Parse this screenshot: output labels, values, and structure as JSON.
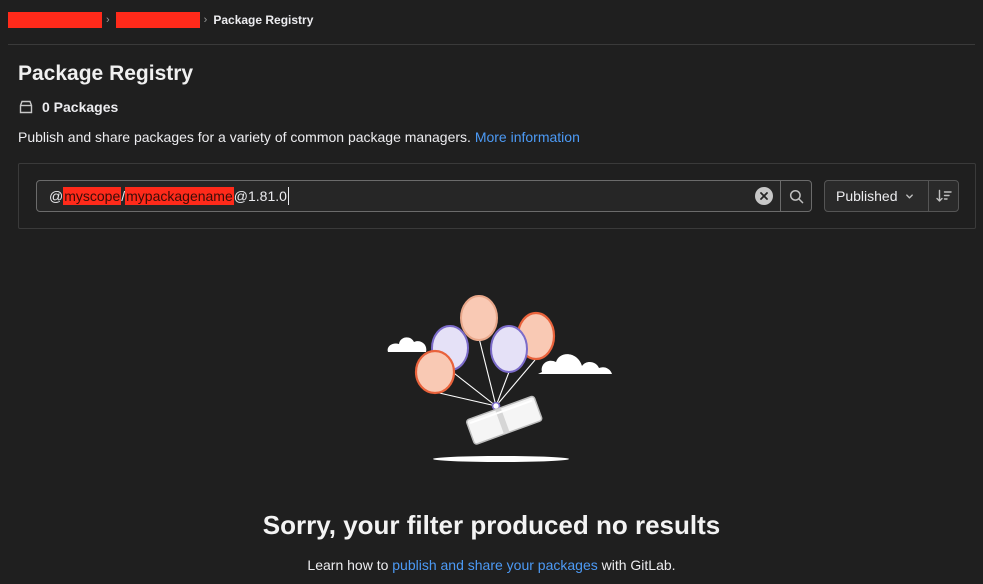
{
  "breadcrumb": {
    "items_redacted": [
      {
        "width": 94
      },
      {
        "width": 84
      }
    ],
    "separator": "›",
    "current": "Package Registry"
  },
  "header": {
    "title": "Package Registry",
    "count_label": "0 Packages",
    "description": "Publish and share packages for a variety of common package managers.",
    "more_info_link": "More information"
  },
  "filter": {
    "search_tokens": {
      "prefix": "@",
      "scope": "myscope",
      "slash": "/",
      "name": "mypackagename",
      "suffix": "@1.81.0"
    },
    "sort_label": "Published"
  },
  "empty_state": {
    "title": "Sorry, your filter produced no results",
    "desc_prefix": "Learn how to ",
    "desc_link": "publish and share your packages",
    "desc_suffix": " with GitLab."
  },
  "colors": {
    "background": "#1f1f1f",
    "link": "#4c9af5",
    "redaction": "#ff2a1a",
    "balloon_peach": "#f9c9b4",
    "balloon_orange": "#e9623b",
    "balloon_lavender": "#e5e1f7",
    "balloon_purple": "#7b6bc9"
  }
}
